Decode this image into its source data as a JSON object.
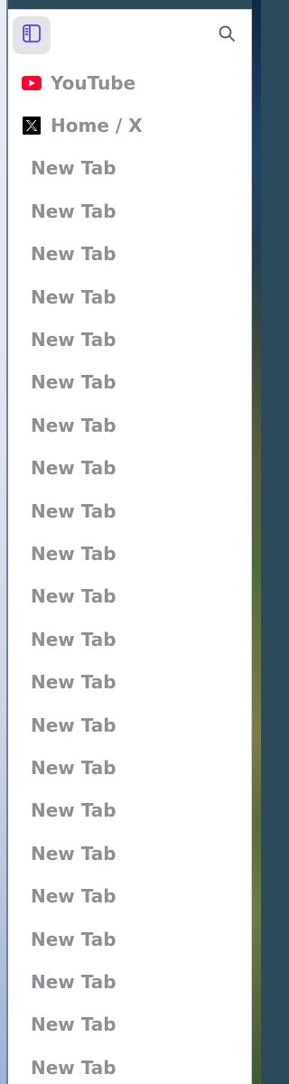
{
  "sidebar": {
    "toggle_icon": "sidebar-toggle-icon",
    "search_icon": "search-icon",
    "colors": {
      "accent": "#4f46e5",
      "youtube_red": "#ff0033",
      "label_gray": "#8e8e93",
      "toggle_bg": "#e4e4e8"
    },
    "tabs": [
      {
        "label": "YouTube",
        "icon": "youtube-icon"
      },
      {
        "label": "Home / X",
        "icon": "x-logo-icon"
      },
      {
        "label": "New Tab"
      },
      {
        "label": "New Tab"
      },
      {
        "label": "New Tab"
      },
      {
        "label": "New Tab"
      },
      {
        "label": "New Tab"
      },
      {
        "label": "New Tab"
      },
      {
        "label": "New Tab"
      },
      {
        "label": "New Tab"
      },
      {
        "label": "New Tab"
      },
      {
        "label": "New Tab"
      },
      {
        "label": "New Tab"
      },
      {
        "label": "New Tab"
      },
      {
        "label": "New Tab"
      },
      {
        "label": "New Tab"
      },
      {
        "label": "New Tab"
      },
      {
        "label": "New Tab"
      },
      {
        "label": "New Tab"
      },
      {
        "label": "New Tab"
      },
      {
        "label": "New Tab"
      },
      {
        "label": "New Tab"
      },
      {
        "label": "New Tab"
      },
      {
        "label": "New Tab"
      }
    ]
  }
}
